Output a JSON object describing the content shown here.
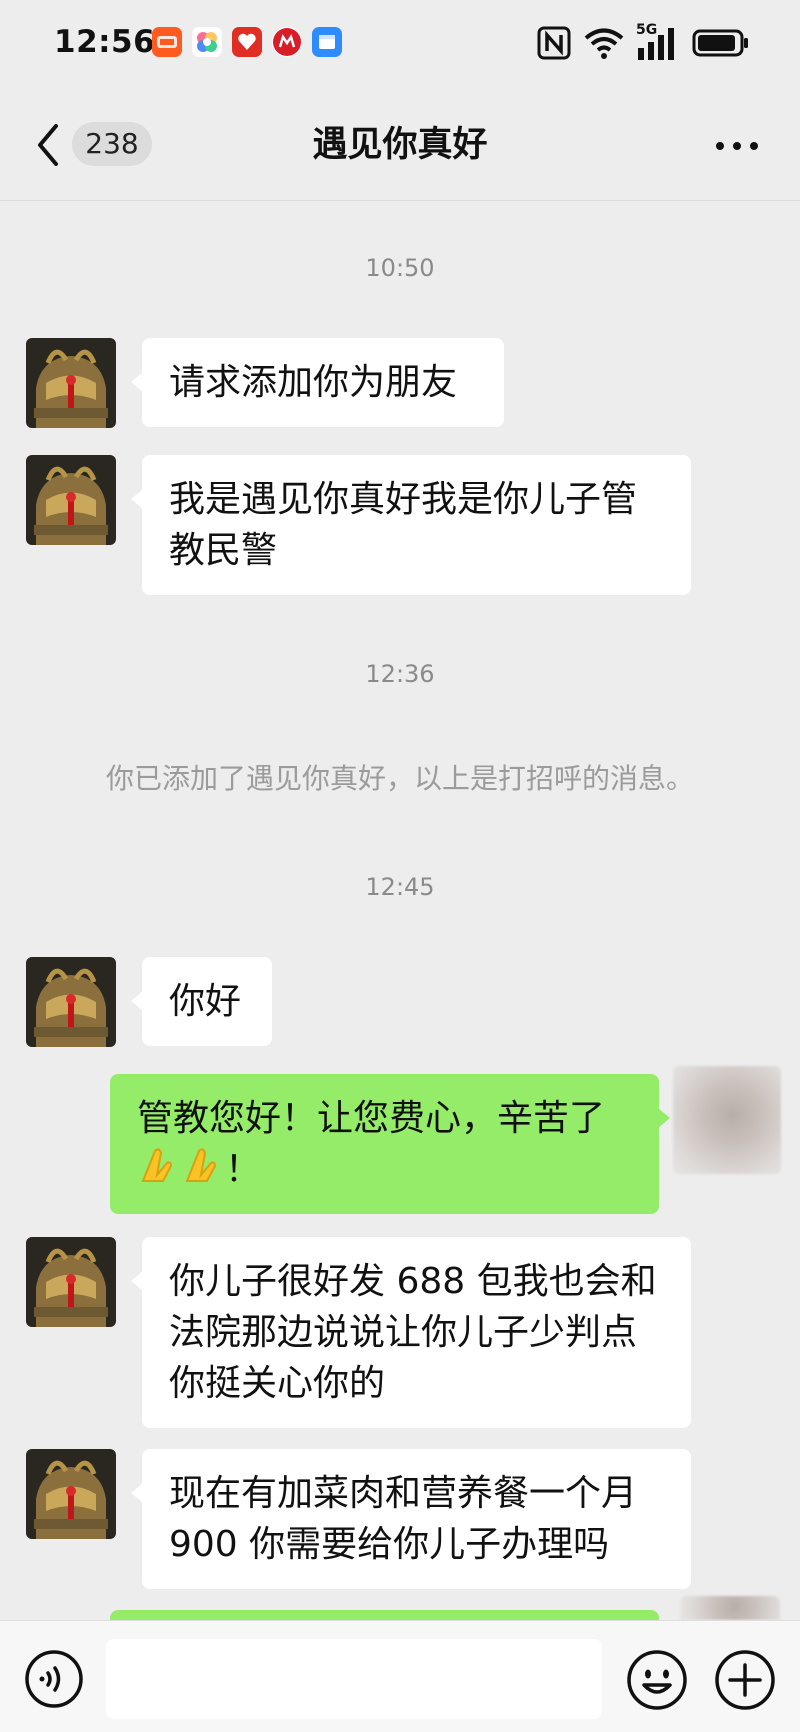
{
  "status_bar": {
    "time": "12:56",
    "network": "5G",
    "icons": [
      "taobao-app-icon",
      "flower-app-icon",
      "pinduoduo-app-icon",
      "bank-app-icon",
      "message-app-icon",
      "nfc-icon",
      "wifi-icon",
      "signal-icon",
      "battery-icon"
    ]
  },
  "header": {
    "unread_count": "238",
    "title": "遇见你真好"
  },
  "messages": [
    {
      "type": "time",
      "text": "10:50"
    },
    {
      "type": "incoming",
      "text": "请求添加你为朋友"
    },
    {
      "type": "incoming",
      "text": "我是遇见你真好我是你儿子管教民警"
    },
    {
      "type": "time",
      "text": "12:36"
    },
    {
      "type": "system",
      "text": "你已添加了遇见你真好，以上是打招呼的消息。"
    },
    {
      "type": "time",
      "text": "12:45"
    },
    {
      "type": "incoming",
      "text": "你好"
    },
    {
      "type": "outgoing",
      "text": "管教您好！让您费心，辛苦了",
      "text_end": "！",
      "emoji": [
        "folded-hands-emoji",
        "folded-hands-emoji"
      ]
    },
    {
      "type": "incoming",
      "text": "你儿子很好发 688 包我也会和法院那边说说让你儿子少判点你挺关心你的"
    },
    {
      "type": "incoming",
      "text": "现在有加菜肉和营养餐一个月 900 你需要给你儿子办理吗"
    }
  ],
  "input_bar": {
    "placeholder": ""
  },
  "colors": {
    "background": "#ededed",
    "incoming_bubble": "#ffffff",
    "outgoing_bubble": "#95ec69",
    "timestamp": "#8a8a8a"
  }
}
